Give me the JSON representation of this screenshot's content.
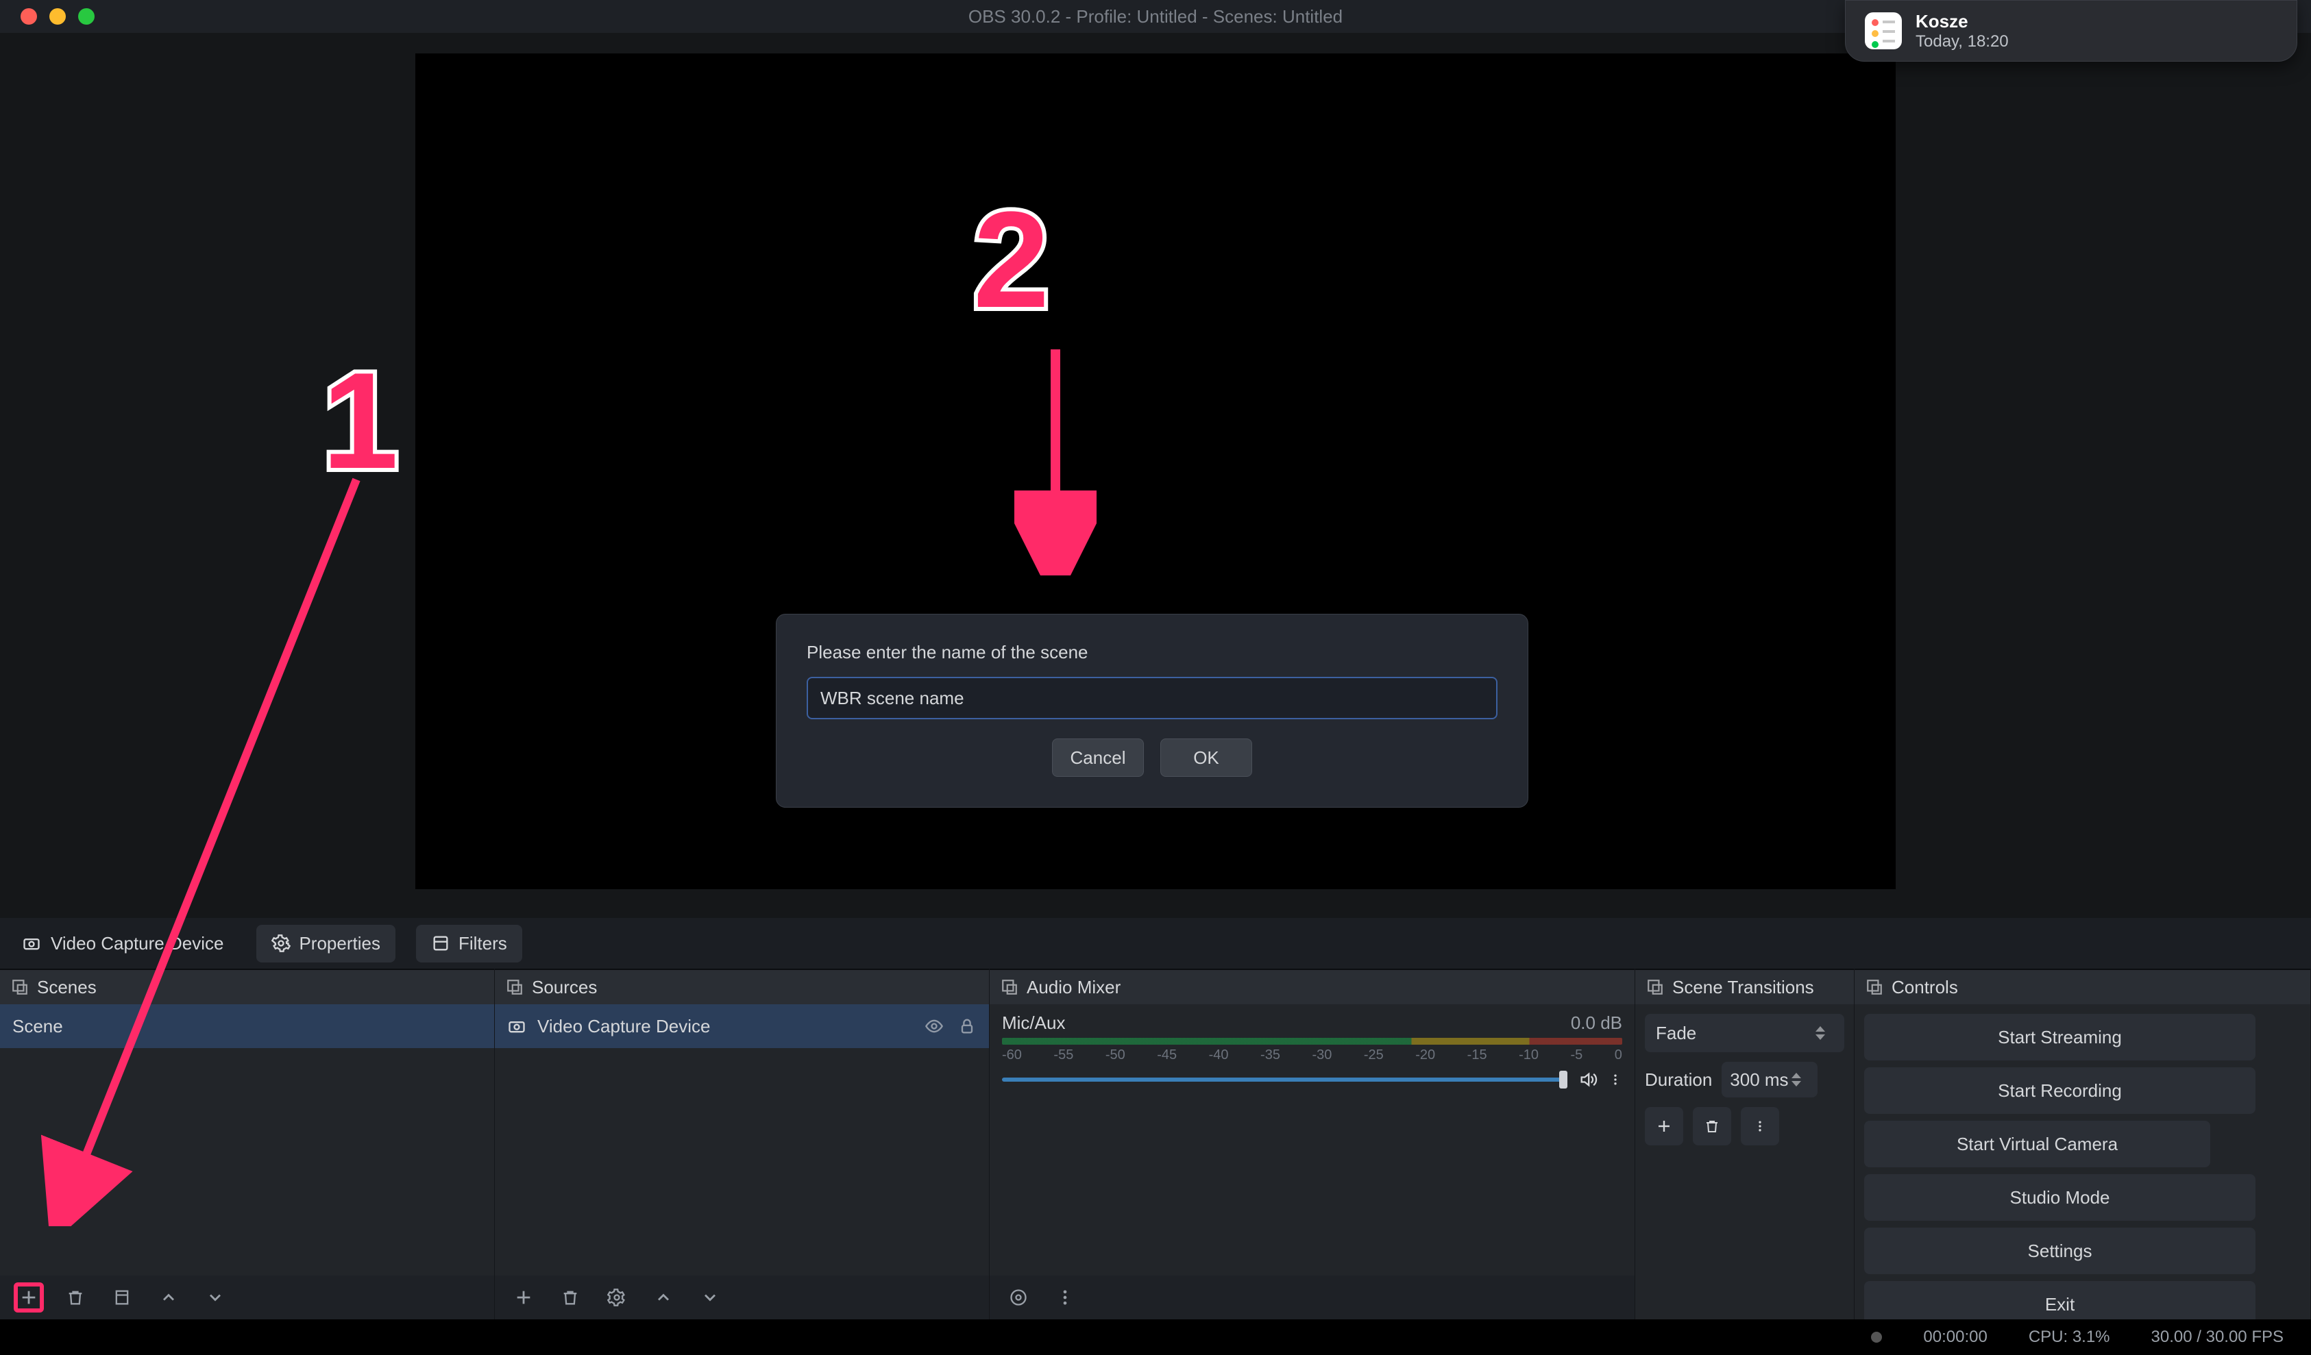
{
  "window": {
    "title": "OBS 30.0.2 - Profile: Untitled - Scenes: Untitled"
  },
  "notification": {
    "title": "Kosze",
    "subtitle": "Today, 18:20"
  },
  "annotations": {
    "label1": "1",
    "label2": "2"
  },
  "dialog": {
    "prompt": "Please enter the name of the scene",
    "input_value": "WBR scene name",
    "cancel_label": "Cancel",
    "ok_label": "OK"
  },
  "context_bar": {
    "source_name": "Video Capture Device",
    "properties_label": "Properties",
    "filters_label": "Filters"
  },
  "panels": {
    "scenes": {
      "title": "Scenes",
      "items": [
        "Scene"
      ]
    },
    "sources": {
      "title": "Sources",
      "items": [
        "Video Capture Device"
      ]
    },
    "mixer": {
      "title": "Audio Mixer",
      "track_name": "Mic/Aux",
      "db_value": "0.0 dB",
      "ticks": [
        "-60",
        "-55",
        "-50",
        "-45",
        "-40",
        "-35",
        "-30",
        "-25",
        "-20",
        "-15",
        "-10",
        "-5",
        "0"
      ]
    },
    "transitions": {
      "title": "Scene Transitions",
      "selected": "Fade",
      "duration_label": "Duration",
      "duration_value": "300 ms"
    },
    "controls": {
      "title": "Controls",
      "buttons": [
        "Start Streaming",
        "Start Recording",
        "Start Virtual Camera",
        "Studio Mode",
        "Settings",
        "Exit"
      ]
    }
  },
  "status_bar": {
    "rec_time": "00:00:00",
    "cpu": "CPU: 3.1%",
    "fps": "30.00 / 30.00 FPS"
  }
}
